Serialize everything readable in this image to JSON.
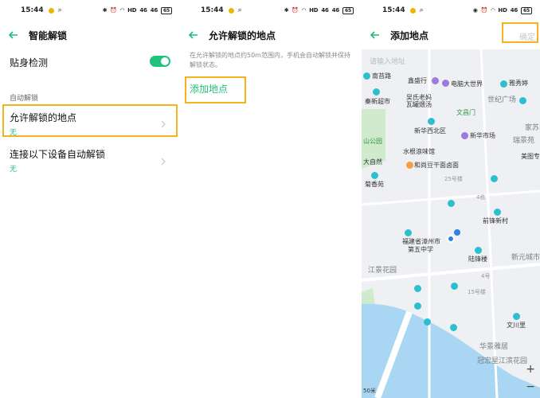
{
  "status": {
    "p1": {
      "time": "15:44"
    },
    "p2": {
      "time": "15:44"
    },
    "p3": {
      "time": "15:44"
    },
    "net": "HD",
    "sig": "46",
    "battery": "65"
  },
  "screen1": {
    "title": "智能解锁",
    "proximity": {
      "label": "贴身检测",
      "enabled": true
    },
    "section": "自动解锁",
    "trusted_places": {
      "label": "允许解锁的地点",
      "value": "无"
    },
    "devices": {
      "label": "连接以下设备自动解锁",
      "value": "无"
    }
  },
  "screen2": {
    "title": "允许解锁的地点",
    "desc": "在允许解锁的地点约50m范围内，手机会自动解锁并保持解锁状态。",
    "add": "添加地点"
  },
  "screen3": {
    "title": "添加地点",
    "top_right": "确定",
    "search_hint": "请输入地址",
    "scale": "50米",
    "map_labels": {
      "a1": "南苔路",
      "a2": "鑫盛行",
      "a3": "电脑大世界",
      "a4": "雅秀婷",
      "a5": "秦新超市",
      "a6": "吴氏老妈",
      "a7": "瓦罐煨汤",
      "a8": "世纪广场",
      "a9": "文昌门",
      "a10": "家苏",
      "a11": "新华西北区",
      "a12": "新华市场",
      "a13": "瑞景苑",
      "a14": "山公园",
      "a15": "水根浪味馆",
      "a16": "美图专",
      "a17": "大自然",
      "a18": "和尚豆干面卤面",
      "a19": "25号楼",
      "a20": "菊香苑",
      "a21": "4栋",
      "a22": "前锋新村",
      "a23": "福建省漳州市",
      "a24": "第五中学",
      "a25": "陆锋楼",
      "a26": "新元城市",
      "a27": "江景花园",
      "a28": "4号",
      "a29": "15号楼",
      "a30": "文川里",
      "a31": "华景雅居",
      "a32": "冠宏星江滨花园"
    },
    "zoom_in": "+",
    "zoom_out": "−"
  }
}
